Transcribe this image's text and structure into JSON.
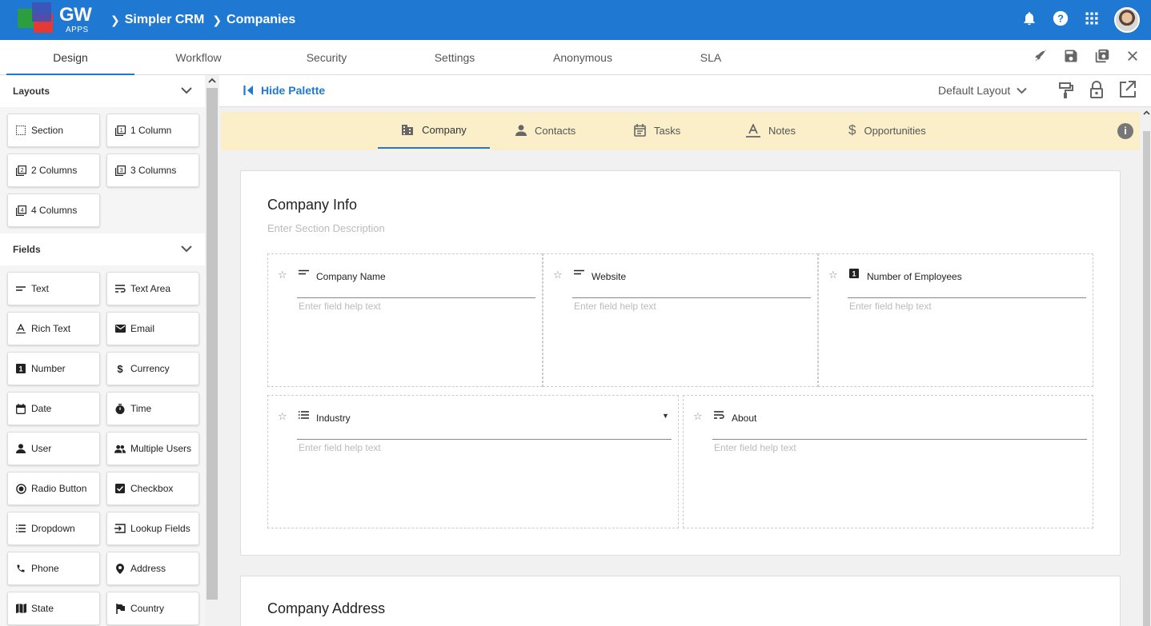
{
  "app": {
    "logo_text": "GW",
    "logo_sub": "APPS",
    "breadcrumbs": [
      "Simpler CRM",
      "Companies"
    ]
  },
  "top_icons": [
    "bell-icon",
    "help-icon",
    "apps-grid-icon",
    "avatar"
  ],
  "tabs": [
    {
      "label": "Design",
      "active": true
    },
    {
      "label": "Workflow"
    },
    {
      "label": "Security"
    },
    {
      "label": "Settings"
    },
    {
      "label": "Anonymous"
    },
    {
      "label": "SLA"
    }
  ],
  "tab_actions": [
    "rocket-icon",
    "save-icon",
    "save-as-icon",
    "close-icon"
  ],
  "palette": {
    "layouts_title": "Layouts",
    "layouts": [
      {
        "label": "Section",
        "icon": "section-icon"
      },
      {
        "label": "1 Column",
        "icon": "one-column-icon"
      },
      {
        "label": "2 Columns",
        "icon": "two-columns-icon"
      },
      {
        "label": "3 Columns",
        "icon": "three-columns-icon"
      },
      {
        "label": "4 Columns",
        "icon": "four-columns-icon"
      }
    ],
    "fields_title": "Fields",
    "fields": [
      {
        "label": "Text",
        "icon": "text-icon"
      },
      {
        "label": "Text Area",
        "icon": "text-area-icon"
      },
      {
        "label": "Rich Text",
        "icon": "rich-text-icon"
      },
      {
        "label": "Email",
        "icon": "email-icon"
      },
      {
        "label": "Number",
        "icon": "number-icon"
      },
      {
        "label": "Currency",
        "icon": "currency-icon"
      },
      {
        "label": "Date",
        "icon": "date-icon"
      },
      {
        "label": "Time",
        "icon": "time-icon"
      },
      {
        "label": "User",
        "icon": "user-icon"
      },
      {
        "label": "Multiple Users",
        "icon": "multiple-users-icon"
      },
      {
        "label": "Radio Button",
        "icon": "radio-button-icon"
      },
      {
        "label": "Checkbox",
        "icon": "checkbox-icon"
      },
      {
        "label": "Dropdown",
        "icon": "dropdown-icon"
      },
      {
        "label": "Lookup Fields",
        "icon": "lookup-fields-icon"
      },
      {
        "label": "Phone",
        "icon": "phone-icon"
      },
      {
        "label": "Address",
        "icon": "address-icon"
      },
      {
        "label": "State",
        "icon": "state-icon"
      },
      {
        "label": "Country",
        "icon": "country-icon"
      }
    ]
  },
  "toolbar": {
    "hide_palette": "Hide Palette",
    "layout_select": "Default Layout",
    "icons": [
      "paint-roller-icon",
      "lock-icon",
      "open-external-icon"
    ]
  },
  "section_tabs": [
    {
      "label": "Company",
      "icon": "building-icon",
      "active": true
    },
    {
      "label": "Contacts",
      "icon": "person-icon"
    },
    {
      "label": "Tasks",
      "icon": "calendar-icon"
    },
    {
      "label": "Notes",
      "icon": "notes-icon"
    },
    {
      "label": "Opportunities",
      "icon": "dollar-icon"
    }
  ],
  "sections": [
    {
      "title": "Company Info",
      "description_placeholder": "Enter Section Description",
      "fields": [
        {
          "label": "Company Name",
          "type_icon": "text-icon",
          "help": "Enter field help text"
        },
        {
          "label": "Website",
          "type_icon": "text-icon",
          "help": "Enter field help text"
        },
        {
          "label": "Number of Employees",
          "type_icon": "number-icon",
          "help": "Enter field help text"
        },
        {
          "label": "Industry",
          "type_icon": "dropdown-icon",
          "help": "Enter field help text"
        },
        {
          "label": "About",
          "type_icon": "text-area-icon",
          "help": "Enter field help text"
        }
      ]
    },
    {
      "title": "Company Address"
    }
  ],
  "colors": {
    "brand": "#1f78d1",
    "tab_strip": "#fbefc9"
  }
}
